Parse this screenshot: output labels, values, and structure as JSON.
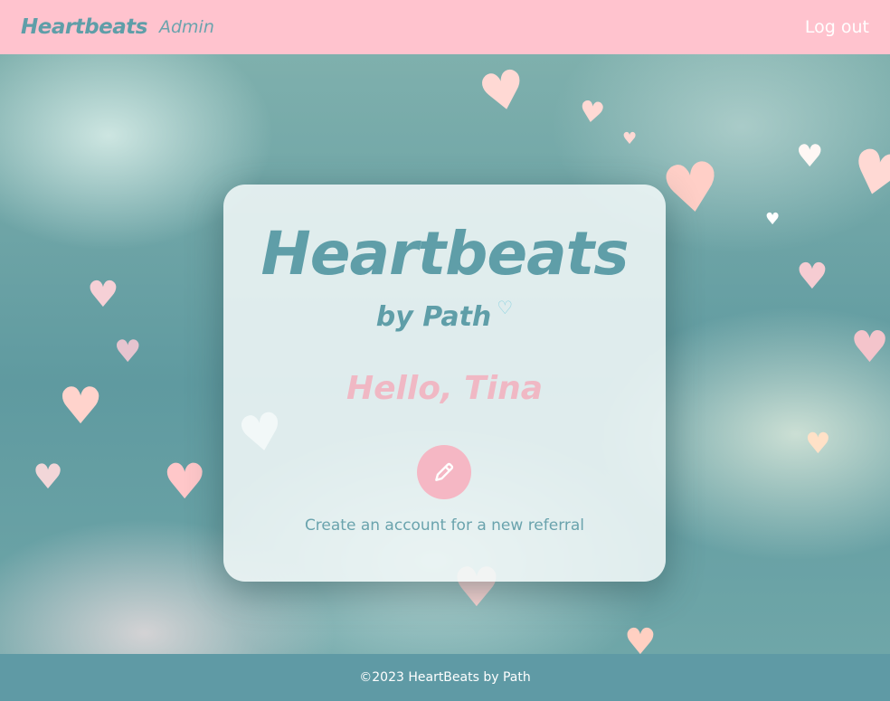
{
  "navbar": {
    "brand": "Heartbeats",
    "section": "Admin",
    "logout_label": "Log out"
  },
  "card": {
    "title": "Heartbeats",
    "subtitle": "by Path",
    "greeting": "Hello, Tina",
    "action_label": "Create an account for a new referral",
    "action_icon": "pencil-icon"
  },
  "footer": {
    "text": "©2023 HeartBeats by Path"
  },
  "colors": {
    "navbar_bg": "#ffc3ce",
    "brand_teal": "#5f9ea8",
    "accent_pink": "#f5b7c4",
    "footer_bg": "#5f9aa5"
  }
}
